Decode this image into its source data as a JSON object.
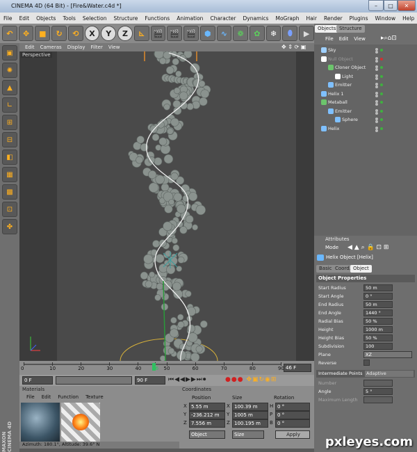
{
  "window": {
    "title": "CINEMA 4D (64 Bit) - [Fire&Water.c4d *]",
    "min": "–",
    "max": "□",
    "close": "✕"
  },
  "menu": [
    "File",
    "Edit",
    "Objects",
    "Tools",
    "Selection",
    "Structure",
    "Functions",
    "Animation",
    "Character",
    "Dynamics",
    "MoGraph",
    "Hair",
    "Render",
    "Plugins",
    "Window",
    "Help"
  ],
  "toolbar": {
    "x": "X",
    "y": "Y",
    "z": "Z"
  },
  "viewport": {
    "menu": [
      "Edit",
      "Cameras",
      "Display",
      "Filter",
      "View"
    ],
    "label": "Perspective",
    "status": "Azimuth: 180.1°, Altitude: 39.6°  N"
  },
  "timeline": {
    "ticks": [
      "0",
      "10",
      "20",
      "30",
      "40",
      "46",
      "50",
      "60",
      "70",
      "80",
      "90"
    ],
    "frame_value": "46 F"
  },
  "playback": {
    "start": "0 F",
    "end": "90 F"
  },
  "materials": {
    "title": "Materials",
    "menu": [
      "File",
      "Edit",
      "Function",
      "Texture"
    ]
  },
  "coordinates": {
    "title": "Coordinates",
    "headers": [
      "Position",
      "Size",
      "Rotation"
    ],
    "rows": [
      {
        "axis": "X",
        "pos": "5.55 m",
        "size_axis": "X",
        "size": "100.39 m",
        "rot_axis": "H",
        "rot": "0 °"
      },
      {
        "axis": "Y",
        "pos": "-236.212 m",
        "size_axis": "Y",
        "size": "1005 m",
        "rot_axis": "P",
        "rot": "0 °"
      },
      {
        "axis": "Z",
        "pos": "7.556 m",
        "size_axis": "Z",
        "size": "100.195 m",
        "rot_axis": "B",
        "rot": "0 °"
      }
    ],
    "mode": "Object",
    "mode2": "Size",
    "apply": "Apply"
  },
  "objects": {
    "tabs": [
      "Objects",
      "Structure"
    ],
    "menu": [
      "File",
      "Edit",
      "View"
    ],
    "items": [
      {
        "name": "Sky",
        "indent": 0,
        "color": "#9fd0ff"
      },
      {
        "name": "Null Object",
        "indent": 0,
        "color": "#ffffff"
      },
      {
        "name": "Cloner Object",
        "indent": 1,
        "color": "#6cc46c"
      },
      {
        "name": "Light",
        "indent": 2,
        "color": "#ffffff"
      },
      {
        "name": "Emitter",
        "indent": 1,
        "color": "#7fc0ff"
      },
      {
        "name": "Helix 1",
        "indent": 0,
        "color": "#7fc0ff"
      },
      {
        "name": "Metaball",
        "indent": 0,
        "color": "#6cc46c"
      },
      {
        "name": "Emitter",
        "indent": 1,
        "color": "#7fc0ff"
      },
      {
        "name": "Sphere",
        "indent": 2,
        "color": "#7fc0ff"
      },
      {
        "name": "Helix",
        "indent": 0,
        "color": "#7fc0ff"
      }
    ]
  },
  "attributes": {
    "title": "Attributes",
    "mode": "Mode",
    "object_name": "Helix Object [Helix]",
    "tabs": [
      "Basic",
      "Coord.",
      "Object"
    ],
    "section": "Object Properties",
    "props": [
      {
        "label": "Start Radius",
        "value": "50 m"
      },
      {
        "label": "Start Angle",
        "value": "0 °"
      },
      {
        "label": "End Radius",
        "value": "50 m"
      },
      {
        "label": "End Angle",
        "value": "1440 °"
      },
      {
        "label": "Radial Bias",
        "value": "50 %"
      },
      {
        "label": "Height",
        "value": "1000 m"
      },
      {
        "label": "Height Bias",
        "value": "50 %"
      },
      {
        "label": "Subdivision",
        "value": "100"
      },
      {
        "label": "Plane",
        "value": "XZ"
      },
      {
        "label": "Reverse",
        "value": ""
      }
    ],
    "interp_label": "Intermediate Points",
    "interp_value": "Adaptive",
    "number_label": "Number",
    "angle_label": "Angle",
    "angle_value": "5 °",
    "maxlen_label": "Maximum Length"
  },
  "brand": {
    "line1": "MAXON",
    "line2": "CINEMA 4D"
  },
  "watermark": "pxleyes.com",
  "colors": {
    "accent_orange": "#ffb020",
    "panel": "#6e6e6e",
    "viewport": "#3b3b3b",
    "selected_tab": "#f0f0f0"
  }
}
